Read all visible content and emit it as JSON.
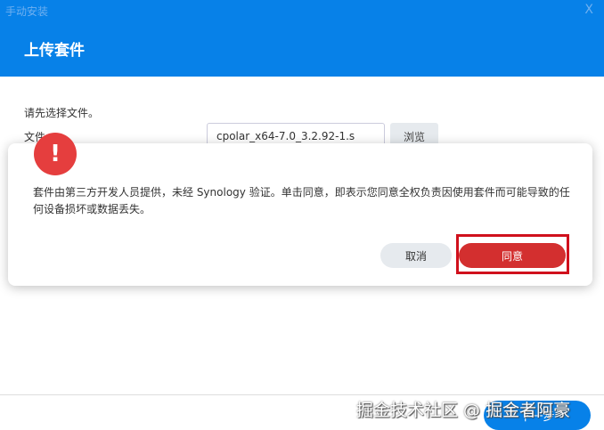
{
  "window": {
    "title": "手动安装",
    "close": "X"
  },
  "header": {
    "title": "上传套件"
  },
  "form": {
    "hint": "请先选择文件。",
    "file_label": "文件",
    "file_value": "cpolar_x64-7.0_3.2.92-1.s",
    "browse": "浏览"
  },
  "footer": {
    "next": "下一步"
  },
  "dialog": {
    "icon": "!",
    "message": "套件由第三方开发人员提供，未经 Synology 验证。单击同意，即表示您同意全权负责因使用套件而可能导致的任何设备损坏或数据丢失。",
    "cancel": "取消",
    "agree": "同意"
  },
  "watermark": "掘金技术社区 @ 掘金者阿豪"
}
